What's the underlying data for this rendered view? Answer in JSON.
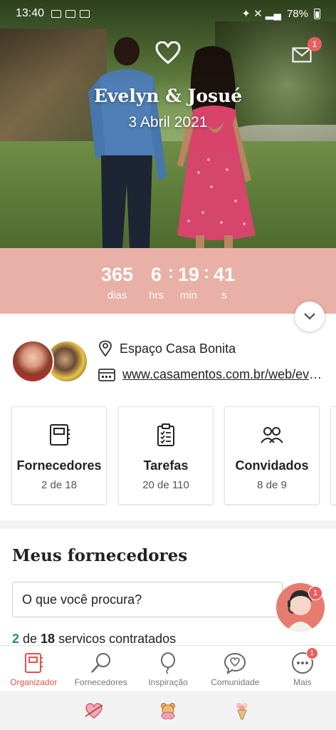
{
  "status_bar": {
    "time": "13:40",
    "battery_pct": "78%"
  },
  "hero": {
    "couple_names": "Evelyn & Josué",
    "wedding_date": "3 Abril 2021",
    "mail_badge": "1"
  },
  "countdown": {
    "days": "365",
    "days_label": "dias",
    "hours": "6",
    "hours_label": "hrs",
    "minutes": "19",
    "minutes_label": "min",
    "seconds": "41",
    "seconds_label": "s"
  },
  "event_info": {
    "venue": "Espaço Casa Bonita",
    "website": "www.casamentos.com.br/web/evelyn-e-josue"
  },
  "tiles": [
    {
      "title": "Fornecedores",
      "count": "2 de 18",
      "icon": "notebook-icon"
    },
    {
      "title": "Tarefas",
      "count": "20 de 110",
      "icon": "checklist-icon"
    },
    {
      "title": "Convidados",
      "count": "8 de 9",
      "icon": "guests-icon"
    }
  ],
  "suppliers": {
    "title": "Meus fornecedores",
    "search_placeholder": "O que você procura?",
    "contracted_count": "2",
    "contracted_of": " de ",
    "contracted_total": "18",
    "contracted_suffix": " servicos contratados",
    "help_badge": "1"
  },
  "bottom_nav": [
    {
      "label": "Organizador",
      "icon": "organizer-icon",
      "active": true
    },
    {
      "label": "Fornecedores",
      "icon": "magnifier-icon",
      "active": false
    },
    {
      "label": "Inspiração",
      "icon": "balloon-icon",
      "active": false
    },
    {
      "label": "Comunidade",
      "icon": "chat-heart-icon",
      "active": false
    },
    {
      "label": "Mais",
      "icon": "more-icon",
      "active": false,
      "badge": "1"
    }
  ],
  "colors": {
    "accent": "#e5524b",
    "countdown_bg": "#e8b0a6",
    "success": "#2f8d6b",
    "badge": "#e95f5f"
  }
}
